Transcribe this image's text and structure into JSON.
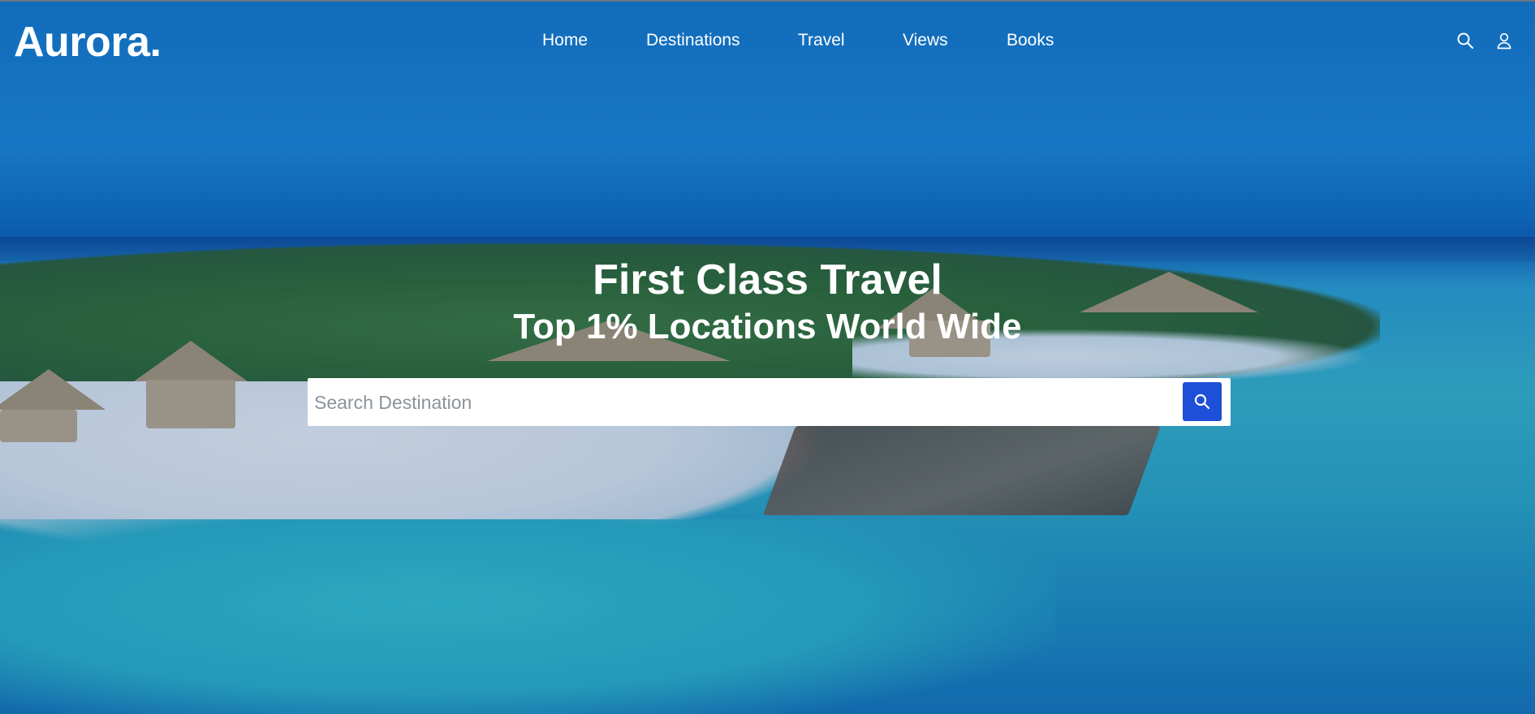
{
  "brand": {
    "logo": "Aurora."
  },
  "nav": {
    "items": [
      "Home",
      "Destinations",
      "Travel",
      "Views",
      "Books"
    ]
  },
  "header_icons": [
    "search-icon",
    "user-icon"
  ],
  "hero": {
    "title": "First Class Travel",
    "subtitle": "Top 1% Locations World Wide",
    "search": {
      "placeholder": "Search Destination",
      "value": ""
    }
  },
  "colors": {
    "accent": "#1e4fd8",
    "text": "#ffffff"
  }
}
